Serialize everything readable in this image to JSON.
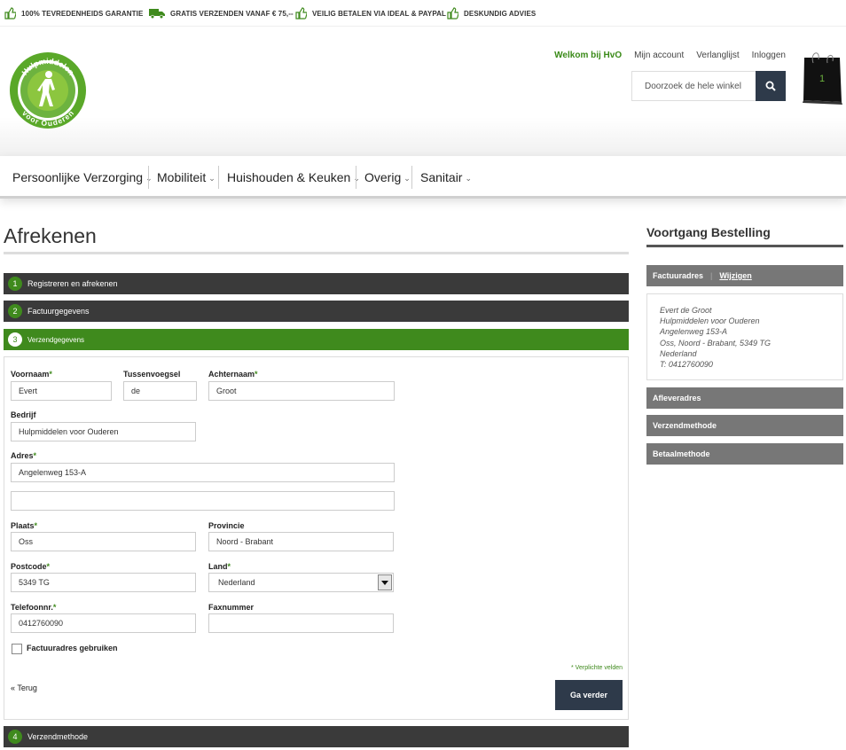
{
  "usp": [
    "100% TEVREDENHEIDS GARANTIE",
    "GRATIS VERZENDEN VANAF € 75,--",
    "VEILIG BETALEN VIA IDEAL & PAYPAL",
    "DESKUNDIG ADVIES"
  ],
  "header": {
    "logo_top": "Hulpmiddelen",
    "logo_bottom": "voor Ouderen",
    "welcome": "Welkom bij HvO",
    "links": [
      "Mijn account",
      "Verlanglijst",
      "Inloggen"
    ],
    "search_placeholder": "Doorzoek de hele winkel",
    "cart_count": "1"
  },
  "nav": [
    "Persoonlijke Verzorging",
    "Mobiliteit",
    "Huishouden & Keuken",
    "Overig",
    "Sanitair"
  ],
  "page": {
    "title": "Afrekenen"
  },
  "steps": [
    {
      "num": "1",
      "label": "Registreren en afrekenen"
    },
    {
      "num": "2",
      "label": "Factuurgegevens"
    },
    {
      "num": "3",
      "label": "Verzendgegevens"
    },
    {
      "num": "4",
      "label": "Verzendmethode"
    }
  ],
  "form": {
    "labels": {
      "voornaam": "Voornaam",
      "tussenvoegsel": "Tussenvoegsel",
      "achternaam": "Achternaam",
      "bedrijf": "Bedrijf",
      "adres": "Adres",
      "plaats": "Plaats",
      "provincie": "Provincie",
      "postcode": "Postcode",
      "land": "Land",
      "telefoon": "Telefoonnr.",
      "fax": "Faxnummer",
      "required_marker": "*"
    },
    "values": {
      "voornaam": "Evert",
      "tussenvoegsel": "de",
      "achternaam": "Groot",
      "bedrijf": "Hulpmiddelen voor Ouderen",
      "adres1": "Angelenweg 153-A",
      "adres2": "",
      "plaats": "Oss",
      "provincie": "Noord - Brabant",
      "postcode": "5349 TG",
      "land": "Nederland",
      "telefoon": "0412760090",
      "fax": ""
    },
    "use_billing_label": "Factuuradres gebruiken",
    "required_note": "* Verplichte velden",
    "back_label": "« Terug",
    "next_label": "Ga verder"
  },
  "sidebar": {
    "title": "Voortgang Bestelling",
    "billing_head": "Factuuradres",
    "edit_label": "Wijzigen",
    "address_lines": [
      "Evert de Groot",
      "Hulpmiddelen voor Ouderen",
      "Angelenweg 153-A",
      "Oss, Noord - Brabant, 5349 TG",
      "Nederland",
      "T: 0412760090"
    ],
    "sections": [
      "Afleveradres",
      "Verzendmethode",
      "Betaalmethode"
    ]
  },
  "colors": {
    "brand_green": "#3f8a1d",
    "dark_bar": "#3a3a3a",
    "navy_button": "#2e3a4a",
    "sidebar_grey": "#777777"
  }
}
